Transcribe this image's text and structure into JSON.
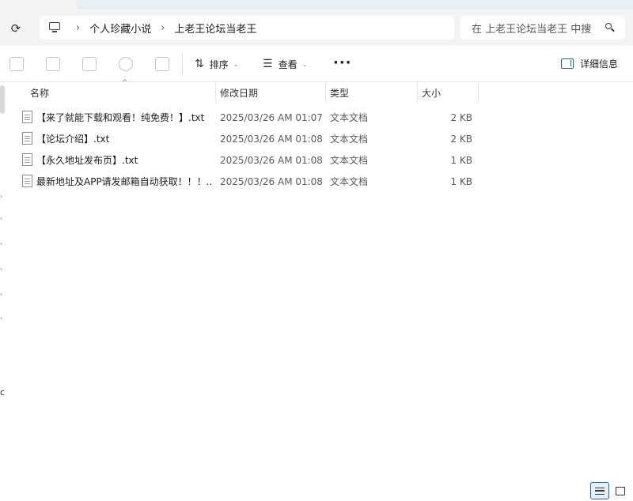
{
  "breadcrumb": {
    "items": [
      "个人珍藏小说",
      "上老王论坛当老王"
    ]
  },
  "search": {
    "placeholder": "在 上老王论坛当老王 中搜"
  },
  "toolbar": {
    "sort_label": "排序",
    "view_label": "查看",
    "more_label": "···",
    "details_label": "详细信息"
  },
  "columns": {
    "name": "名称",
    "modified": "修改日期",
    "type": "类型",
    "size": "大小"
  },
  "files": [
    {
      "name": "【来了就能下载和观看！纯免费！】.txt",
      "modified": "2025/03/26 AM 01:07",
      "type": "文本文档",
      "size": "2 KB"
    },
    {
      "name": "【论坛介绍】.txt",
      "modified": "2025/03/26 AM 01:08",
      "type": "文本文档",
      "size": "2 KB"
    },
    {
      "name": "【永久地址发布页】.txt",
      "modified": "2025/03/26 AM 01:08",
      "type": "文本文档",
      "size": "1 KB"
    },
    {
      "name": "最新地址及APP请发邮箱自动获取！！！....",
      "modified": "2025/03/26 AM 01:08",
      "type": "文本文档",
      "size": "1 KB"
    }
  ],
  "nav_cut_text": "c",
  "icons": {
    "refresh": "refresh-icon",
    "pc": "this-pc-icon",
    "search": "search-icon",
    "sort": "sort-icon",
    "view": "view-icon",
    "details": "details-pane-icon"
  }
}
